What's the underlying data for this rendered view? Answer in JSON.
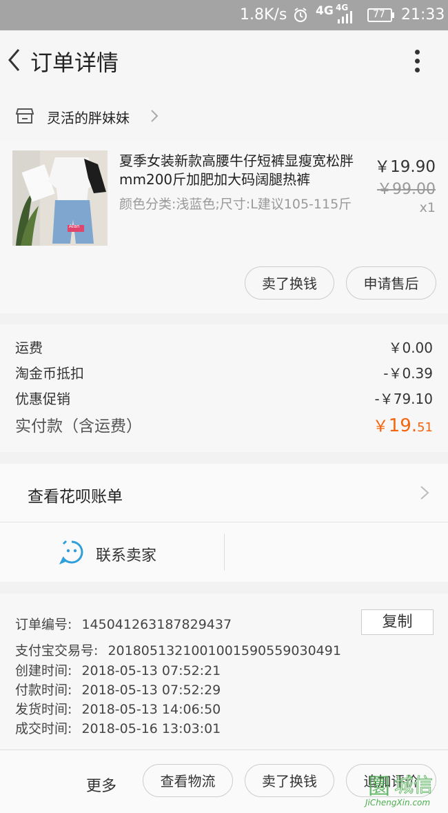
{
  "status_bar": {
    "net_speed": "1.8K/s",
    "network_1": "4G",
    "network_2": "4G",
    "battery": "77",
    "time": "21:33"
  },
  "header": {
    "title": "订单详情"
  },
  "shop": {
    "name": "灵活的胖妹妹"
  },
  "product": {
    "title": "夏季女装新款高腰牛仔短裤显瘦宽松胖mm200斤加肥加大码阔腿热裤",
    "sku": "颜色分类:浅蓝色;尺寸:L建议105-115斤",
    "price": "￥19.90",
    "original_price": "￥99.00",
    "quantity": "x1",
    "image_tag": "Alan",
    "actions": [
      "卖了换钱",
      "申请售后"
    ]
  },
  "costs": {
    "rows": [
      {
        "label": "运费",
        "value": "￥0.00"
      },
      {
        "label": "淘金币抵扣",
        "value": "-￥0.39"
      },
      {
        "label": "优惠促销",
        "value": "-￥79.10"
      }
    ],
    "total_label": "实付款（含运费）",
    "total_currency": "￥",
    "total_int": "19.",
    "total_dec": "51",
    "total_color": "#f5640d"
  },
  "huabei": {
    "label": "查看花呗账单"
  },
  "contact": {
    "label": "联系卖家",
    "icon_color": "#2e9fd8"
  },
  "order_info": {
    "rows": [
      {
        "label": "订单编号:",
        "value": "145041263187829437"
      },
      {
        "label": "支付宝交易号:",
        "value": "2018051321001001590559030491"
      },
      {
        "label": "创建时间:",
        "value": "2018-05-13 07:52:21"
      },
      {
        "label": "付款时间:",
        "value": "2018-05-13 07:52:29"
      },
      {
        "label": "发货时间:",
        "value": "2018-05-13 14:06:50"
      },
      {
        "label": "成交时间:",
        "value": "2018-05-16 13:03:01"
      }
    ],
    "copy_label": "复制"
  },
  "bottom_bar": {
    "more_label": "更多",
    "buttons": [
      "查看物流",
      "卖了换钱",
      "追加评价"
    ]
  },
  "watermark": {
    "icon_char": "圜",
    "chars": "城信",
    "url": "JiChengXin.com"
  }
}
